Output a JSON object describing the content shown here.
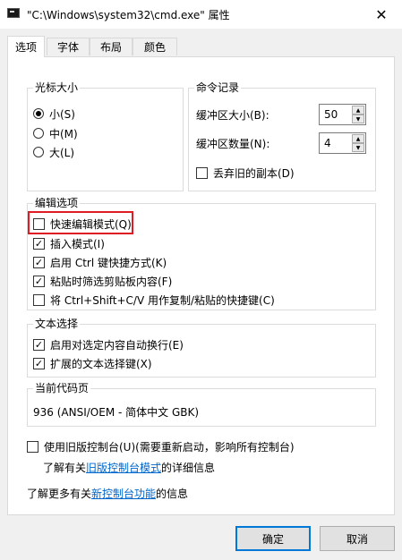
{
  "window": {
    "title": "\"C:\\Windows\\system32\\cmd.exe\" 属性",
    "close_glyph": "✕"
  },
  "tabs": [
    "选项",
    "字体",
    "布局",
    "颜色"
  ],
  "cursor_size": {
    "title": "光标大小",
    "options": [
      "小(S)",
      "中(M)",
      "大(L)"
    ],
    "selected": "小(S)"
  },
  "command_history": {
    "title": "命令记录",
    "buffer_size_label": "缓冲区大小(B):",
    "buffer_size_value": "50",
    "buffer_count_label": "缓冲区数量(N):",
    "buffer_count_value": "4",
    "discard_label": "丢弃旧的副本(D)",
    "discard_checked": false
  },
  "edit_options": {
    "title": "编辑选项",
    "items": [
      {
        "label": "快速编辑模式(Q)",
        "checked": false
      },
      {
        "label": "插入模式(I)",
        "checked": true
      },
      {
        "label": "启用 Ctrl 键快捷方式(K)",
        "checked": true
      },
      {
        "label": "粘贴时筛选剪贴板内容(F)",
        "checked": true
      },
      {
        "label": "将 Ctrl+Shift+C/V 用作复制/粘贴的快捷键(C)",
        "checked": false
      }
    ]
  },
  "text_selection": {
    "title": "文本选择",
    "items": [
      {
        "label": "启用对选定内容自动换行(E)",
        "checked": true
      },
      {
        "label": "扩展的文本选择键(X)",
        "checked": true
      }
    ]
  },
  "code_page": {
    "title": "当前代码页",
    "value": "936   (ANSI/OEM - 简体中文 GBK)"
  },
  "legacy": {
    "label": "使用旧版控制台(U)(需要重新启动，影响所有控制台)",
    "checked": false,
    "info_prefix": "了解有关",
    "info_link": "旧版控制台模式",
    "info_suffix": "的详细信息"
  },
  "more_info": {
    "prefix": "了解更多有关",
    "link": "新控制台功能",
    "suffix": "的信息"
  },
  "buttons": {
    "ok": "确定",
    "cancel": "取消"
  },
  "colors": {
    "highlight": "#e01b24",
    "link": "#0066cc",
    "primary_button_border": "#0078d7"
  }
}
